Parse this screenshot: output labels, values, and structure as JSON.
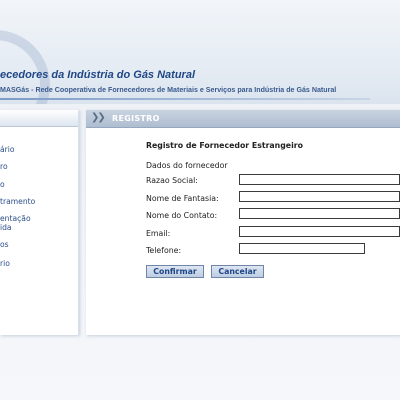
{
  "header": {
    "title": "ecedores da Indústria do Gás Natural",
    "subtitle": "MASGás - Rede Cooperativa de Fornecedores de Materiais e Serviços para Indústria de Gás Natural"
  },
  "sidebar": {
    "items": [
      {
        "label": "ário"
      },
      {
        "label": "ro"
      },
      {
        "label": "o"
      },
      {
        "label": "tramento"
      },
      {
        "label": "entação"
      },
      {
        "label": "ida"
      },
      {
        "label": "os"
      },
      {
        "label": "rio"
      }
    ]
  },
  "panel": {
    "title": "REGISTRO",
    "heading": "Registro de Fornecedor Estrangeiro",
    "section_label": "Dados do fornecedor",
    "fields": [
      {
        "label": "Razao Social:",
        "value": ""
      },
      {
        "label": "Nome de Fantasia:",
        "value": ""
      },
      {
        "label": "Nome do Contato:",
        "value": ""
      },
      {
        "label": "Email:",
        "value": ""
      },
      {
        "label": "Telefone:",
        "value": ""
      }
    ],
    "buttons": {
      "confirm": "Confirmar",
      "cancel": "Cancelar"
    }
  }
}
